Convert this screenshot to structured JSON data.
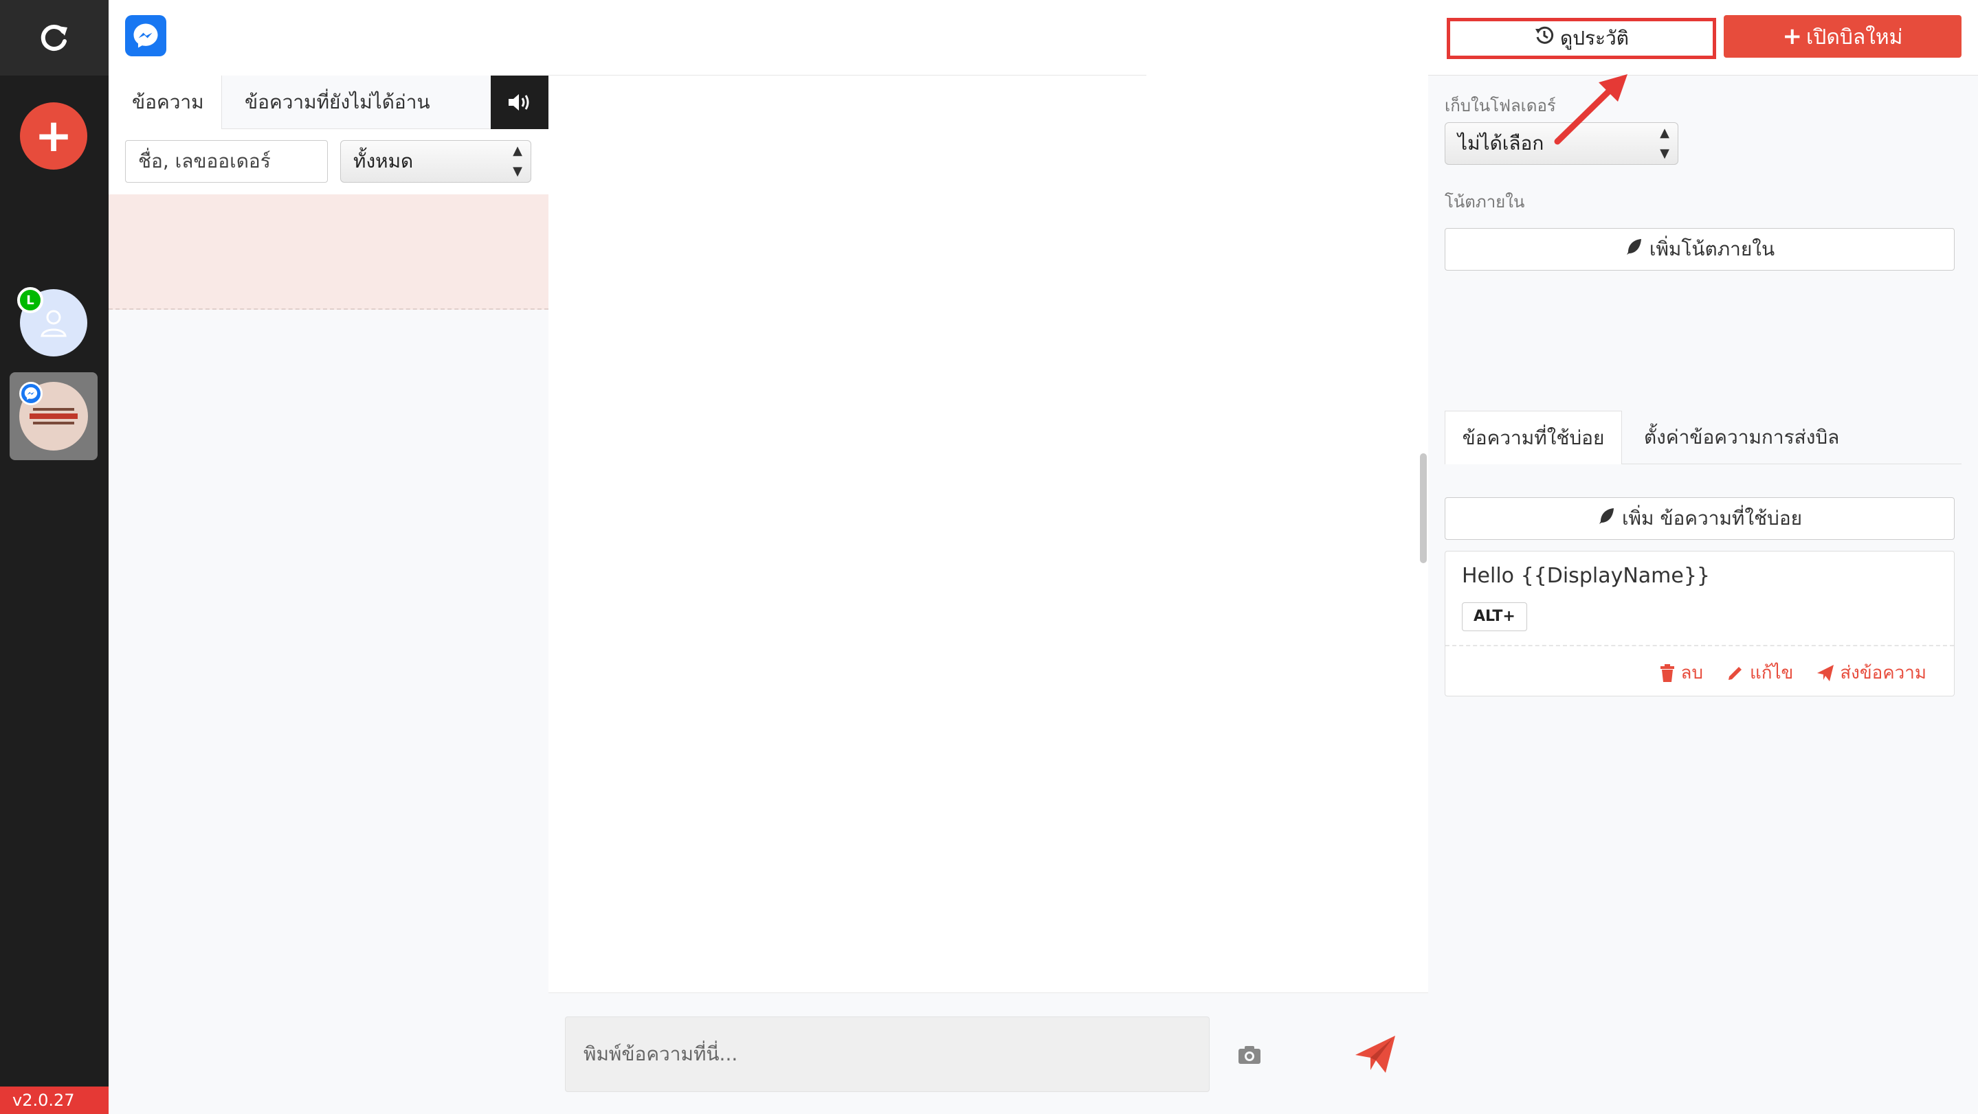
{
  "rail": {
    "version": "v2.0.27",
    "line_badge": "L"
  },
  "list": {
    "tabs": [
      "ข้อความ",
      "ข้อความที่ยังไม่ได้อ่าน"
    ],
    "search_placeholder": "ชื่อ, เลขออเดอร์",
    "filter_value": "ทั้งหมด"
  },
  "chat": {
    "input_placeholder": "พิมพ์ข้อความที่นี่..."
  },
  "right": {
    "history_label": "ดูประวัติ",
    "new_bill_label": "เปิดบิลใหม่",
    "folder_label": "เก็บในโฟลเดอร์",
    "folder_value": "ไม่ได้เลือก",
    "note_label": "โน้ตภายใน",
    "add_note_label": "เพิ่มโน้ตภายใน",
    "tabs": [
      "ข้อความที่ใช้บ่อย",
      "ตั้งค่าข้อความการส่งบิล"
    ],
    "add_quick_label": "เพิ่ม ข้อความที่ใช้บ่อย",
    "quick_reply": {
      "text": "Hello {{DisplayName}}",
      "shortcut": "ALT+",
      "delete_label": "ลบ",
      "edit_label": "แก้ไข",
      "send_label": "ส่งข้อความ"
    }
  },
  "colors": {
    "accent_red": "#e74c3c",
    "messenger_blue": "#1877f2",
    "line_green": "#00b900",
    "rail_dark": "#1e1e1e"
  },
  "icons": {
    "refresh": "refresh-icon",
    "add": "plus-icon",
    "speaker": "speaker-icon",
    "history": "history-icon",
    "feather": "feather-icon",
    "trash": "trash-icon",
    "pencil": "pencil-icon",
    "send": "send-icon",
    "camera": "camera-icon"
  }
}
